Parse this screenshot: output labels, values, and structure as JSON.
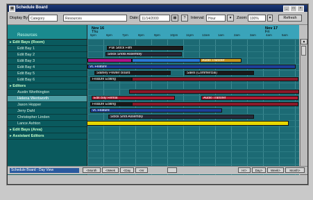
{
  "window": {
    "title": "Schedule Board",
    "controls": [
      "_",
      "□",
      "×"
    ]
  },
  "toolbar": {
    "display_by_label": "Display By:",
    "display_by_value": "Category",
    "filter_value": "Resources",
    "date_label": "Date:",
    "date_value": "11/14/2000",
    "interval_label": "Interval:",
    "interval_value": "Hour",
    "zoom_label": "Zoom:",
    "zoom_value": "100%",
    "refresh_label": "Refresh"
  },
  "tree": {
    "header": "Resources",
    "rows": [
      {
        "label": "Edit Bays (Room)",
        "kind": "group"
      },
      {
        "label": "Edit Bay 1",
        "kind": "item"
      },
      {
        "label": "Edit Bay 2",
        "kind": "item"
      },
      {
        "label": "Edit Bay 3",
        "kind": "item"
      },
      {
        "label": "Edit Bay 4",
        "kind": "item"
      },
      {
        "label": "Edit Bay 5",
        "kind": "item"
      },
      {
        "label": "Edit Bay 6",
        "kind": "item"
      },
      {
        "label": "Editors",
        "kind": "group"
      },
      {
        "label": "Austin Worthington",
        "kind": "item"
      },
      {
        "label": "Helena Wentworth",
        "kind": "selected"
      },
      {
        "label": "Jason Hopper",
        "kind": "item"
      },
      {
        "label": "Jerry Dahl",
        "kind": "item"
      },
      {
        "label": "Christopher Linden",
        "kind": "item"
      },
      {
        "label": "Lance Ashton",
        "kind": "item"
      },
      {
        "label": "Edit Bays (Area)",
        "kind": "group"
      },
      {
        "label": "Assistant Editors",
        "kind": "group"
      }
    ]
  },
  "timeline": {
    "dates": [
      "Nov 16",
      "Nov 17"
    ],
    "day_sub": [
      "Thu",
      "Fri"
    ],
    "ticks": [
      "5pm",
      "6pm",
      "7pm",
      "8pm",
      "9pm",
      "10pm",
      "11pm",
      "12am",
      "1am",
      "2am",
      "3am",
      "4am",
      "5am"
    ]
  },
  "bars": [
    {
      "row": 1,
      "label": "Pull Stock Film",
      "color": "#1a1a1a"
    },
    {
      "row": 2,
      "label": "Stock Shots Assembly",
      "color": "#2a2a3a"
    },
    {
      "row": 3,
      "label": "",
      "color": "#b0128a"
    },
    {
      "row": 3,
      "label": "",
      "color": "#2a7ad8"
    },
    {
      "row": 3,
      "label": "Audio Transfer",
      "color": "#c89a20"
    },
    {
      "row": 4,
      "label": "Vt. Feature",
      "color": "#1d3f9a"
    },
    {
      "row": 5,
      "label": "Stanley Pewter Board",
      "color": "#1a1a1a"
    },
    {
      "row": 5,
      "label": "Sales (Commercial)",
      "color": "#1a1a1a"
    },
    {
      "row": 6,
      "label": "Feature Editing",
      "color": "#1a1a1a"
    },
    {
      "row": 6,
      "label": "",
      "color": "#8a1a2a"
    },
    {
      "row": 8,
      "label": "",
      "color": "#8a1a2a"
    },
    {
      "row": 9,
      "label": "Edit Bay Rental",
      "color": "#b01a30"
    },
    {
      "row": 9,
      "label": "Audio Transfer",
      "color": "#b01a30"
    },
    {
      "row": 10,
      "label": "Feature Editing",
      "color": "#1a1a1a"
    },
    {
      "row": 10,
      "label": "",
      "color": "#8a1a2a"
    },
    {
      "row": 11,
      "label": "Vt. Feature",
      "color": "#1d3f9a"
    },
    {
      "row": 12,
      "label": "Stock Shot Assembly",
      "color": "#2a2a3a"
    },
    {
      "row": 13,
      "label": "",
      "color": "#e8d800"
    }
  ],
  "statusbar": {
    "status": "Schedule Board - Day View",
    "nav_left": [
      "<Month",
      "<Week",
      "<Day",
      "<Hr"
    ],
    "nav_right": [
      "Hr>",
      "Day>",
      "Week>",
      "Month>"
    ]
  }
}
